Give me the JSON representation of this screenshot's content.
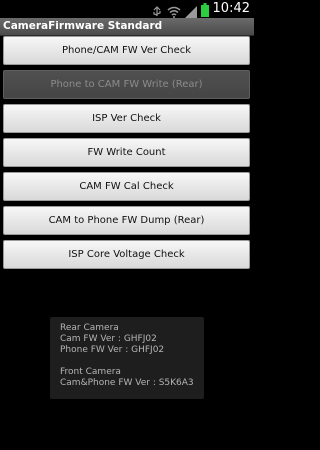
{
  "status_bar": {
    "time": "10:42",
    "icons": [
      "usb-icon",
      "wifi-icon",
      "signal-icon",
      "battery-icon"
    ],
    "battery_color": "#2ecc40"
  },
  "app": {
    "title": "CameraFirmware Standard"
  },
  "buttons": [
    {
      "label": "Phone/CAM FW Ver Check",
      "enabled": true
    },
    {
      "label": "Phone to CAM FW Write (Rear)",
      "enabled": false
    },
    {
      "label": "ISP Ver Check",
      "enabled": true
    },
    {
      "label": "FW Write Count",
      "enabled": true
    },
    {
      "label": "CAM FW Cal Check",
      "enabled": true
    },
    {
      "label": "CAM to Phone FW Dump (Rear)",
      "enabled": true
    },
    {
      "label": "ISP Core Voltage Check",
      "enabled": true
    }
  ],
  "info": {
    "rear_heading": "Rear Camera",
    "rear_cam_fw": "Cam FW Ver : GHFJ02",
    "rear_phone_fw": "Phone FW Ver : GHFJ02",
    "front_heading": "Front Camera",
    "front_fw": "Cam&Phone FW Ver : S5K6A3"
  }
}
